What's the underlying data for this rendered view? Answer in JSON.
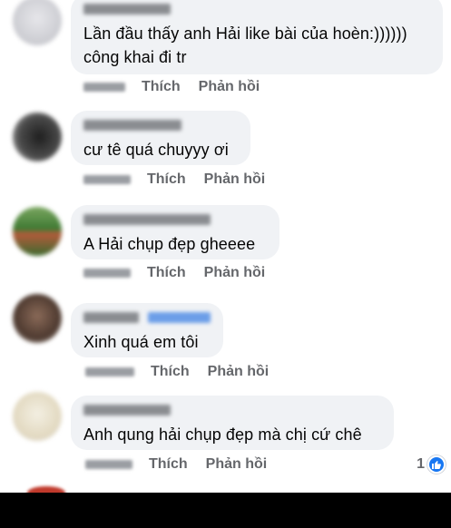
{
  "comments": [
    {
      "text_lines": [
        "Lần đầu thấy anh Hải like bài của hoèn:))))))",
        "công khai đi tr"
      ],
      "actions": {
        "like": "Thích",
        "reply": "Phản hồi"
      },
      "avatar_color": "#cfcfd4"
    },
    {
      "text_lines": [
        "cư tê quá chuyyy ơi"
      ],
      "actions": {
        "like": "Thích",
        "reply": "Phản hồi"
      },
      "avatar_color": "#3a3a3a"
    },
    {
      "text_lines": [
        "A Hải chụp đẹp gheeee"
      ],
      "actions": {
        "like": "Thích",
        "reply": "Phản hồi"
      },
      "avatar_color": "#4f8a3a"
    },
    {
      "text_lines": [
        "Xinh quá em tôi"
      ],
      "actions": {
        "like": "Thích",
        "reply": "Phản hồi"
      },
      "avatar_color": "#5a4438"
    },
    {
      "text_lines": [
        "Anh qung hải chụp đẹp mà chị cứ chê"
      ],
      "actions": {
        "like": "Thích",
        "reply": "Phản hồi"
      },
      "avatar_color": "#e9e2cf",
      "reaction": {
        "count": "1",
        "icon": "thumbs-up-icon",
        "color": "#1877f2"
      }
    }
  ],
  "colors": {
    "bubble": "#f0f2f5",
    "action_text": "#65676b",
    "like_blue": "#1877f2"
  }
}
